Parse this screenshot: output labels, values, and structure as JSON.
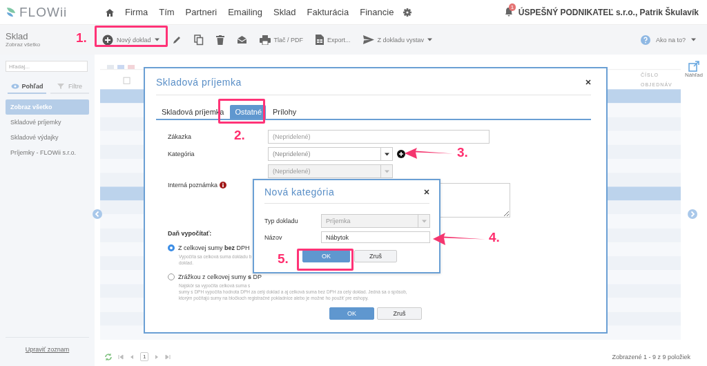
{
  "app": {
    "logo": "FLOWii"
  },
  "nav": {
    "items": [
      "Firma",
      "Tím",
      "Partneri",
      "Emailing",
      "Sklad",
      "Fakturácia",
      "Financie"
    ],
    "notifications": "1",
    "account": "ÚSPEŠNÝ PODNIKATEĽ s.r.o., Patrik Škulavík"
  },
  "toolbar": {
    "title": "Sklad",
    "subtitle": "Zobraz všetko",
    "buttons": [
      {
        "kind": "labeled",
        "label": "Nový doklad",
        "dropdown": true
      },
      {
        "kind": "icon"
      },
      {
        "kind": "icon"
      },
      {
        "kind": "icon"
      },
      {
        "kind": "icon"
      },
      {
        "kind": "labeled",
        "label": "Tlač / PDF",
        "dropdown": false
      },
      {
        "kind": "labeled",
        "label": "Export...",
        "dropdown": false
      },
      {
        "kind": "labeled",
        "label": "Z dokladu vystav",
        "dropdown": true
      }
    ],
    "help": "Ako na to?"
  },
  "sidebar": {
    "search_placeholder": "Hľadaj...",
    "tabs": [
      {
        "label": "Pohľad",
        "selected": true
      },
      {
        "label": "Filtre",
        "selected": false
      }
    ],
    "items": [
      {
        "label": "Zobraz všetko",
        "selected": true
      },
      {
        "label": "Skladové príjemky",
        "selected": false
      },
      {
        "label": "Skladové výdajky",
        "selected": false
      },
      {
        "label": "Príjemky - FLOWii s.r.o.",
        "selected": false
      }
    ],
    "footer_link": "Upraviť zoznam"
  },
  "table": {
    "column_header": "ČÍSLO OBJEDNÁV"
  },
  "preview": {
    "label": "Náhľad"
  },
  "pager": {
    "page": "1",
    "summary": "Zobrazené 1 - 9 z 9 položiek"
  },
  "dialog": {
    "title": "Skladová príjemka",
    "tabs": [
      {
        "label": "Skladová príjemka",
        "selected": false
      },
      {
        "label": "Ostatné",
        "selected": true
      },
      {
        "label": "Prílohy",
        "selected": false
      }
    ],
    "fields": [
      {
        "kind": "text",
        "label": "Zákazka",
        "placeholder": "(Nepridelené)"
      },
      {
        "kind": "select",
        "label": "Kategória",
        "placeholder": "(Nepridelené)",
        "disabled": false,
        "add_button": true
      },
      {
        "kind": "select",
        "placeholder": "(Nepridelené)",
        "disabled": true
      },
      {
        "kind": "textarea",
        "label": "Interná poznámka",
        "info": true
      }
    ],
    "tax": {
      "heading": "Daň vypočítať:",
      "options": [
        {
          "label": "Z celkovej sumy **bez** DPH",
          "selected": true,
          "description": [
            "Vypočíta sa celková suma dokladu b",
            "doklad."
          ]
        },
        {
          "label": "Zrážkou z celkovej sumy **s** DP",
          "selected": false,
          "description": [
            "Najskôr sa vypočíta celková suma s",
            "sumy s DPH vypočíta hodnota DPH za celý doklad a aj celková suma bez DPH za celý doklad. Jedná sa o spôsob,",
            "ktorým počítajú sumy na bločkoch registračné pokladnice alebo je možné ho použiť pre eshopy."
          ]
        }
      ]
    },
    "buttons": [
      {
        "label": "OK",
        "primary": true
      },
      {
        "label": "Zruš",
        "primary": false
      }
    ]
  },
  "subdialog": {
    "title": "Nová kategória",
    "fields": [
      {
        "kind": "select",
        "label": "Typ dokladu",
        "value": "Príjemka",
        "disabled": true
      },
      {
        "kind": "text",
        "label": "Názov",
        "value": "Nábytok"
      }
    ],
    "buttons": [
      {
        "label": "OK",
        "primary": true
      },
      {
        "label": "Zruš",
        "primary": false
      }
    ]
  },
  "annotations": [
    {
      "label": "1.",
      "kind": "box"
    },
    {
      "label": "2.",
      "kind": "box"
    },
    {
      "label": "3.",
      "kind": "arrow"
    },
    {
      "label": "4.",
      "kind": "arrow"
    },
    {
      "label": "5.",
      "kind": "box"
    }
  ]
}
